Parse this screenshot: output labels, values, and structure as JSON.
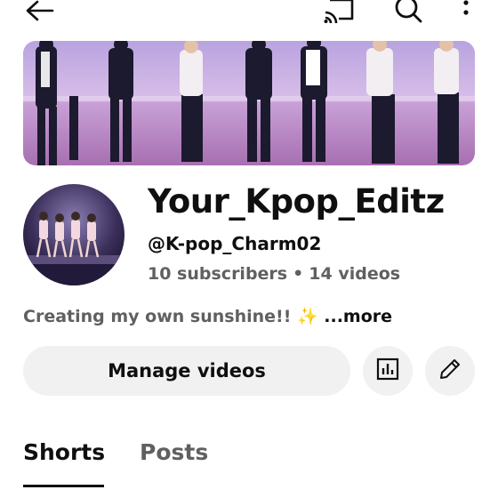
{
  "header": {
    "back_icon": "arrow-left-icon",
    "cast_icon": "cast-icon",
    "search_icon": "search-icon",
    "more_icon": "more-vertical-icon"
  },
  "channel": {
    "name": "Your_Kpop_Editz",
    "handle": "@K-pop_Charm02",
    "subscribers": "10 subscribers",
    "separator": "•",
    "videos": "14 videos",
    "description": "Creating my own sunshine!! ✨",
    "more_label": "...more"
  },
  "actions": {
    "manage_label": "Manage videos",
    "analytics_icon": "analytics-icon",
    "edit_icon": "pencil-icon"
  },
  "tabs": [
    {
      "label": "Shorts",
      "selected": true
    },
    {
      "label": "Posts",
      "selected": false
    }
  ],
  "colors": {
    "text_primary": "#0f0f0f",
    "text_secondary": "#606060",
    "button_bg": "#f1f1f1",
    "banner_sky": "#c9b3e6",
    "banner_floor": "#b57ab8"
  }
}
